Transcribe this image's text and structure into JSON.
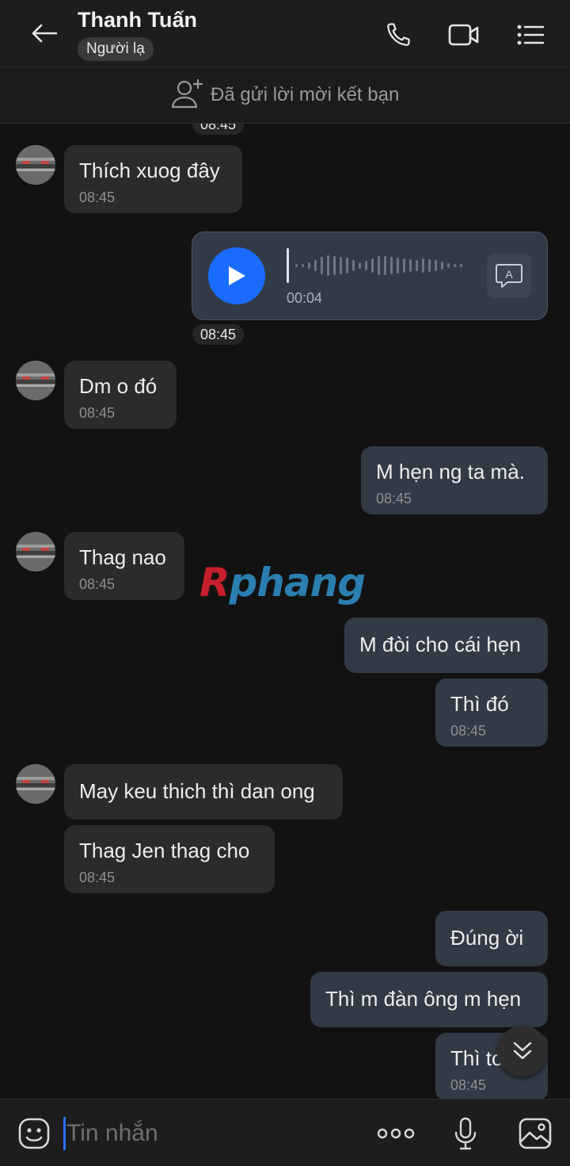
{
  "header": {
    "contact_name": "Thanh Tuấn",
    "badge": "Người lạ"
  },
  "request_bar": {
    "text": "Đã gửi lời mời kết bạn"
  },
  "chips": {
    "top_partial": "08:45",
    "voice_time": "08:45"
  },
  "voice_message": {
    "duration": "00:04"
  },
  "messages": [
    {
      "text": "Thích xuog đây",
      "time": "08:45"
    },
    {
      "text": "Dm o đó",
      "time": "08:45"
    },
    {
      "text": "M hẹn ng ta mà.",
      "time": "08:45"
    },
    {
      "text": "Thag nao",
      "time": "08:45"
    },
    {
      "text": "M đòi cho cái hẹn",
      "time": ""
    },
    {
      "text": "Thì đó",
      "time": "08:45"
    },
    {
      "text": "May keu thich thì dan ong",
      "time": ""
    },
    {
      "text": "Thag Jen thag cho",
      "time": "08:45"
    },
    {
      "text": "Đúng ời",
      "time": ""
    },
    {
      "text": "Thì m đàn ông m hẹn",
      "time": ""
    },
    {
      "text": "Thì to",
      "time": "08:45"
    }
  ],
  "watermark": {
    "first": "R",
    "rest": "phang"
  },
  "input": {
    "placeholder": "Tin nhắn"
  },
  "colors": {
    "accent": "#1a6cff",
    "incoming_bubble": "#2b2b2b",
    "outgoing_bubble": "#323a46",
    "background": "#121212"
  }
}
